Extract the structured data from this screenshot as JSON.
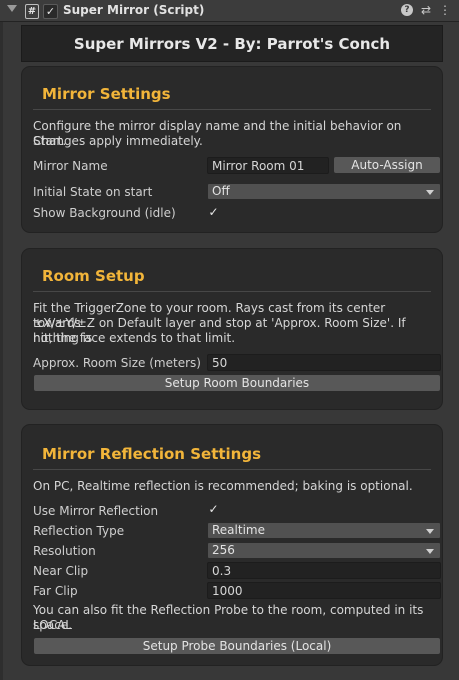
{
  "component": {
    "title": "Super Mirror (Script)",
    "script_icon": "#",
    "enabled_check": "✓",
    "icons": [
      "help-icon",
      "preset-icon",
      "kebab-menu-icon"
    ]
  },
  "banner": "Super Mirrors V2 - By: Parrot's Conch",
  "mirror_settings": {
    "title": "Mirror Settings",
    "desc1": "Configure the mirror display name and the initial behavior on Start.",
    "desc2": "Changes apply immediately.",
    "name_label": "Mirror Name",
    "name_value": "Mirror Room 01",
    "auto_assign": "Auto-Assign",
    "state_label": "Initial State on start",
    "state_value": "Off",
    "bg_label": "Show Background (idle)",
    "bg_check": "✓"
  },
  "room_setup": {
    "title": "Room Setup",
    "desc1": "Fit the TriggerZone to your room. Rays cast from its center towards",
    "desc2": "±X/±Y/±Z on Default layer and stop at 'Approx. Room Size'. If nothing is",
    "desc3": "hit, the face extends to that limit.",
    "size_label": "Approx. Room Size (meters)",
    "size_value": "50",
    "setup_button": "Setup Room Boundaries"
  },
  "reflection": {
    "title": "Mirror Reflection Settings",
    "desc1": "On PC, Realtime reflection is recommended; baking is optional.",
    "use_label": "Use Mirror Reflection",
    "use_check": "✓",
    "type_label": "Reflection Type",
    "type_value": "Realtime",
    "res_label": "Resolution",
    "res_value": "256",
    "near_label": "Near Clip",
    "near_value": "0.3",
    "far_label": "Far Clip",
    "far_value": "1000",
    "note1": "You can also fit the Reflection Probe to the room, computed in its LOCAL",
    "note2": "space.",
    "probe_button": "Setup Probe Boundaries (Local)"
  }
}
